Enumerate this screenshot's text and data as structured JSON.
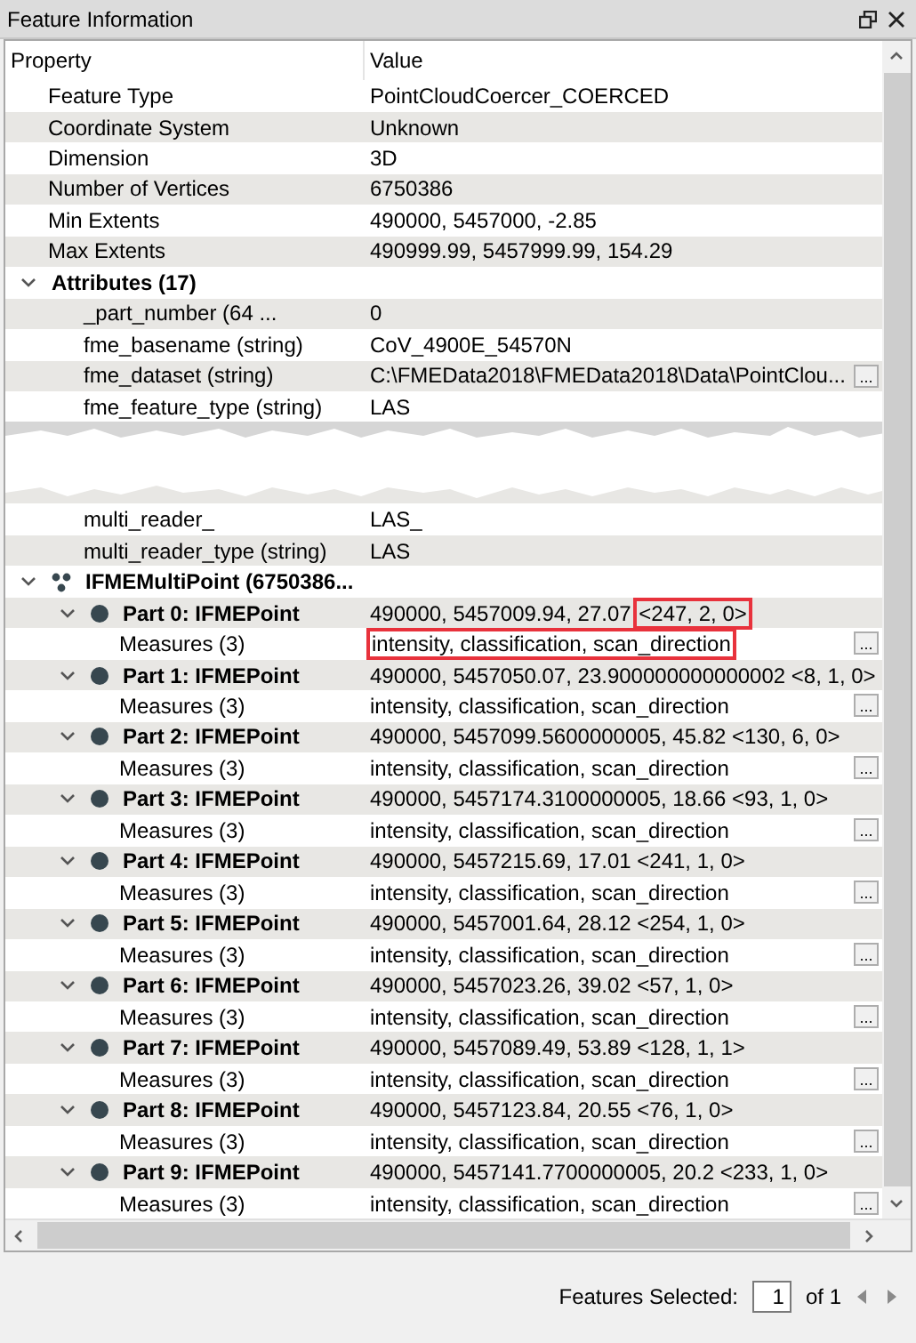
{
  "panel": {
    "title": "Feature Information"
  },
  "table": {
    "columns": [
      "Property",
      "Value"
    ],
    "rows": [
      {
        "kind": "property",
        "name": "Feature Type",
        "value": "PointCloudCoercer_COERCED"
      },
      {
        "kind": "property",
        "name": "Coordinate System",
        "value": "Unknown"
      },
      {
        "kind": "property",
        "name": "Dimension",
        "value": "3D"
      },
      {
        "kind": "property",
        "name": "Number of Vertices",
        "value": "6750386"
      },
      {
        "kind": "property",
        "name": "Min Extents",
        "value": "490000, 5457000, -2.85"
      },
      {
        "kind": "property",
        "name": "Max Extents",
        "value": "490999.99, 5457999.99, 154.29"
      },
      {
        "kind": "group",
        "name": "Attributes (17)",
        "expanded": true,
        "children": [
          {
            "kind": "property",
            "name": "_part_number (64 ...",
            "value": "0"
          },
          {
            "kind": "property",
            "name": "fme_basename (string)",
            "value": "CoV_4900E_54570N"
          },
          {
            "kind": "property",
            "name": "fme_dataset (string)",
            "value": "C:\\FMEData2018\\FMEData2018\\Data\\PointClou...",
            "button": "..."
          },
          {
            "kind": "property",
            "name": "fme_feature_type (string)",
            "value": "LAS"
          },
          {
            "kind": "tear"
          },
          {
            "kind": "property",
            "name": "multi_reader_",
            "value": "LAS_"
          },
          {
            "kind": "property",
            "name": "multi_reader_type (string)",
            "value": "LAS"
          }
        ]
      },
      {
        "kind": "geometry",
        "name": "IFMEMultiPoint (6750386...",
        "expanded": true,
        "children": [
          {
            "kind": "part",
            "name": "Part 0: IFMEPoint",
            "coords": "490000, 5457009.94, 27.07",
            "measure_values": "<247, 2, 0>",
            "highlighted": true,
            "expanded": true,
            "children": [
              {
                "kind": "property",
                "name": "Measures (3)",
                "value": "intensity, classification, scan_direction",
                "button": "...",
                "highlighted": true
              }
            ]
          },
          {
            "kind": "part",
            "name": "Part 1: IFMEPoint",
            "coords": "490000, 5457050.07, 23.900000000000002",
            "measure_values": "<8, 1, 0>",
            "highlighted": false,
            "expanded": true,
            "children": [
              {
                "kind": "property",
                "name": "Measures (3)",
                "value": "intensity, classification, scan_direction",
                "button": "...",
                "highlighted": false
              }
            ]
          },
          {
            "kind": "part",
            "name": "Part 2: IFMEPoint",
            "coords": "490000, 5457099.5600000005, 45.82",
            "measure_values": "<130, 6, 0>",
            "highlighted": false,
            "expanded": true,
            "children": [
              {
                "kind": "property",
                "name": "Measures (3)",
                "value": "intensity, classification, scan_direction",
                "button": "...",
                "highlighted": false
              }
            ]
          },
          {
            "kind": "part",
            "name": "Part 3: IFMEPoint",
            "coords": "490000, 5457174.3100000005, 18.66",
            "measure_values": "<93, 1, 0>",
            "highlighted": false,
            "expanded": true,
            "children": [
              {
                "kind": "property",
                "name": "Measures (3)",
                "value": "intensity, classification, scan_direction",
                "button": "...",
                "highlighted": false
              }
            ]
          },
          {
            "kind": "part",
            "name": "Part 4: IFMEPoint",
            "coords": "490000, 5457215.69, 17.01",
            "measure_values": "<241, 1, 0>",
            "highlighted": false,
            "expanded": true,
            "children": [
              {
                "kind": "property",
                "name": "Measures (3)",
                "value": "intensity, classification, scan_direction",
                "button": "...",
                "highlighted": false
              }
            ]
          },
          {
            "kind": "part",
            "name": "Part 5: IFMEPoint",
            "coords": "490000, 5457001.64, 28.12",
            "measure_values": "<254, 1, 0>",
            "highlighted": false,
            "expanded": true,
            "children": [
              {
                "kind": "property",
                "name": "Measures (3)",
                "value": "intensity, classification, scan_direction",
                "button": "...",
                "highlighted": false
              }
            ]
          },
          {
            "kind": "part",
            "name": "Part 6: IFMEPoint",
            "coords": "490000, 5457023.26, 39.02",
            "measure_values": "<57, 1, 0>",
            "highlighted": false,
            "expanded": true,
            "children": [
              {
                "kind": "property",
                "name": "Measures (3)",
                "value": "intensity, classification, scan_direction",
                "button": "...",
                "highlighted": false
              }
            ]
          },
          {
            "kind": "part",
            "name": "Part 7: IFMEPoint",
            "coords": "490000, 5457089.49, 53.89",
            "measure_values": "<128, 1, 1>",
            "highlighted": false,
            "expanded": true,
            "children": [
              {
                "kind": "property",
                "name": "Measures (3)",
                "value": "intensity, classification, scan_direction",
                "button": "...",
                "highlighted": false
              }
            ]
          },
          {
            "kind": "part",
            "name": "Part 8: IFMEPoint",
            "coords": "490000, 5457123.84, 20.55",
            "measure_values": "<76, 1, 0>",
            "highlighted": false,
            "expanded": true,
            "children": [
              {
                "kind": "property",
                "name": "Measures (3)",
                "value": "intensity, classification, scan_direction",
                "button": "...",
                "highlighted": false
              }
            ]
          },
          {
            "kind": "part",
            "name": "Part 9: IFMEPoint",
            "coords": "490000, 5457141.7700000005, 20.2",
            "measure_values": "<233, 1, 0>",
            "highlighted": false,
            "expanded": true,
            "children": [
              {
                "kind": "property",
                "name": "Measures (3)",
                "value": "intensity, classification, scan_direction",
                "button": "...",
                "highlighted": false
              }
            ]
          }
        ]
      }
    ]
  },
  "footer": {
    "label": "Features Selected:",
    "value": "1",
    "total": "of 1"
  }
}
